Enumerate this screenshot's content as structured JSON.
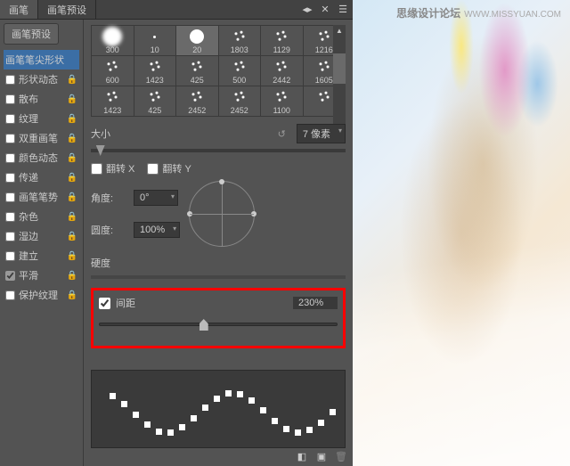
{
  "watermark": {
    "cn": "思缘设计论坛",
    "url": "WWW.MISSYUAN.COM"
  },
  "tabs": {
    "brush": "画笔",
    "presets_tab": "画笔预设"
  },
  "sidebar": {
    "preset_btn": "画笔预设",
    "items": [
      {
        "label": "画笔笔尖形状",
        "checked": null,
        "highlight": true,
        "lock": false
      },
      {
        "label": "形状动态",
        "checked": false,
        "lock": true
      },
      {
        "label": "散布",
        "checked": false,
        "lock": true
      },
      {
        "label": "纹理",
        "checked": false,
        "lock": true
      },
      {
        "label": "双重画笔",
        "checked": false,
        "lock": true
      },
      {
        "label": "颜色动态",
        "checked": false,
        "lock": true
      },
      {
        "label": "传递",
        "checked": false,
        "lock": true
      },
      {
        "label": "画笔笔势",
        "checked": false,
        "lock": true
      },
      {
        "label": "杂色",
        "checked": false,
        "lock": true
      },
      {
        "label": "湿边",
        "checked": false,
        "lock": true
      },
      {
        "label": "建立",
        "checked": false,
        "lock": true
      },
      {
        "label": "平滑",
        "checked": true,
        "lock": true
      },
      {
        "label": "保护纹理",
        "checked": false,
        "lock": true
      }
    ]
  },
  "brushes": [
    [
      "300",
      "10",
      "20",
      "1803",
      "1129",
      "1216"
    ],
    [
      "600",
      "1423",
      "425",
      "500",
      "2442",
      "1605"
    ],
    [
      "1423",
      "425",
      "2452",
      "2452",
      "1100",
      ""
    ]
  ],
  "size": {
    "label": "大小",
    "value": "7 像素"
  },
  "flip": {
    "x": "翻转 X",
    "y": "翻转 Y"
  },
  "angle": {
    "label": "角度:",
    "value": "0°"
  },
  "roundness": {
    "label": "圆度:",
    "value": "100%"
  },
  "hardness": {
    "label": "硬度"
  },
  "spacing": {
    "label": "间距",
    "value": "230%",
    "checked": true
  },
  "colors": {
    "highlight_red": "#ff0000",
    "panel_bg": "#535353"
  }
}
